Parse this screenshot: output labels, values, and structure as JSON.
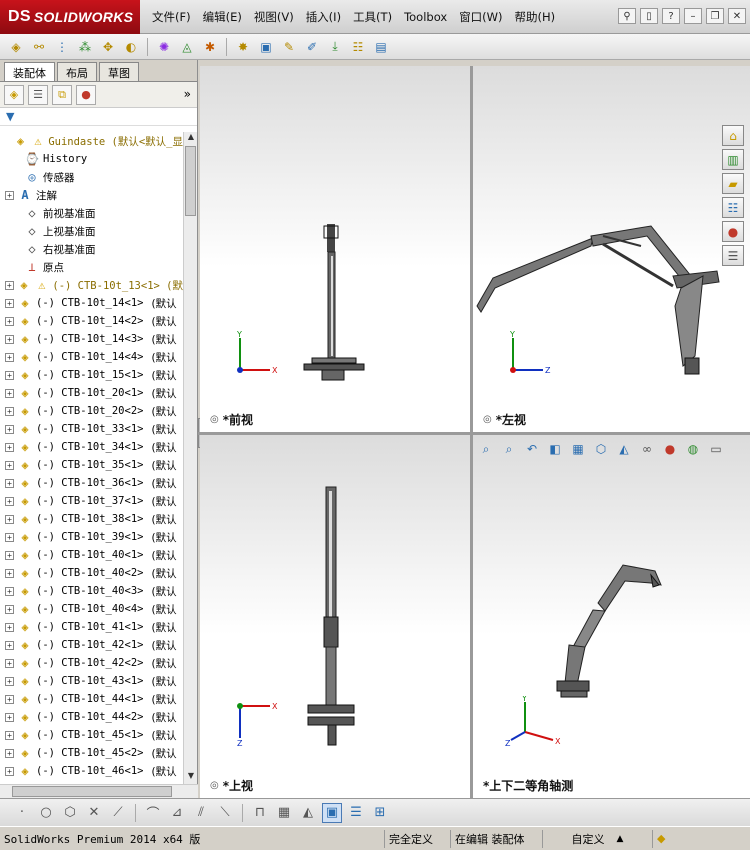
{
  "app": {
    "logo_text": "SOLIDWORKS",
    "logo_prefix": "DS"
  },
  "menu": [
    "文件(F)",
    "编辑(E)",
    "视图(V)",
    "插入(I)",
    "工具(T)",
    "Toolbox",
    "窗口(W)",
    "帮助(H)"
  ],
  "feature_tabs": [
    "装配体",
    "布局",
    "草图"
  ],
  "tree": {
    "root": "Guindaste  (默认<默认_显",
    "fixed_items": [
      "History",
      "传感器",
      "注解",
      "前视基准面",
      "上视基准面",
      "右视基准面",
      "原点"
    ],
    "first_component": "(-) CTB-10t_13<1> (默",
    "components": [
      "(-) CTB-10t_14<1>",
      "(-) CTB-10t_14<2>",
      "(-) CTB-10t_14<3>",
      "(-) CTB-10t_14<4>",
      "(-) CTB-10t_15<1>",
      "(-) CTB-10t_20<1>",
      "(-) CTB-10t_20<2>",
      "(-) CTB-10t_33<1>",
      "(-) CTB-10t_34<1>",
      "(-) CTB-10t_35<1>",
      "(-) CTB-10t_36<1>",
      "(-) CTB-10t_37<1>",
      "(-) CTB-10t_38<1>",
      "(-) CTB-10t_39<1>",
      "(-) CTB-10t_40<1>",
      "(-) CTB-10t_40<2>",
      "(-) CTB-10t_40<3>",
      "(-) CTB-10t_40<4>",
      "(-) CTB-10t_41<1>",
      "(-) CTB-10t_42<1>",
      "(-) CTB-10t_42<2>",
      "(-) CTB-10t_43<1>",
      "(-) CTB-10t_44<1>",
      "(-) CTB-10t_44<2>",
      "(-) CTB-10t_45<1>",
      "(-) CTB-10t_45<2>",
      "(-) CTB-10t_46<1>"
    ],
    "config_suffix": "(默认"
  },
  "viewports": {
    "front": "*前视",
    "left": "*左视",
    "top": "*上视",
    "iso": "*上下二等角轴测"
  },
  "axes": {
    "x": "X",
    "y": "Y",
    "z": "Z"
  },
  "status": {
    "product": "SolidWorks Premium 2014 x64 版",
    "definition": "完全定义",
    "mode": "在编辑 装配体",
    "units": "自定义"
  },
  "colors": {
    "brand_red": "#c8131b",
    "axis_x": "#d01010",
    "axis_y": "#109010",
    "axis_z": "#1030c0"
  }
}
